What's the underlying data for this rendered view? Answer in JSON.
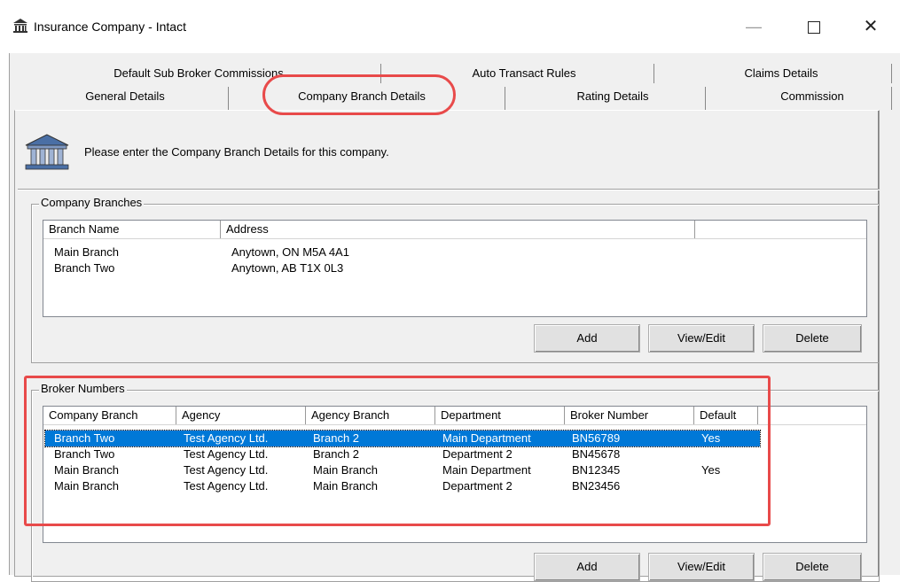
{
  "window": {
    "title": "Insurance Company - Intact",
    "min_glyph": "—",
    "close_glyph": "✕"
  },
  "tabs": {
    "row1": [
      "Default Sub Broker Commissions",
      "Auto Transact Rules",
      "Claims Details"
    ],
    "row2": [
      "General Details",
      "Company Branch Details",
      "Rating Details",
      "Commission"
    ],
    "active": "Company Branch Details"
  },
  "info": {
    "message": "Please enter the Company Branch Details for this company."
  },
  "company_branches": {
    "label": "Company Branches",
    "columns": [
      "Branch Name",
      "Address",
      ""
    ],
    "rows": [
      [
        "Main Branch",
        "Anytown, ON M5A 4A1"
      ],
      [
        "Branch Two",
        "Anytown, AB T1X 0L3"
      ]
    ],
    "buttons": {
      "add": "Add",
      "view_edit": "View/Edit",
      "delete": "Delete"
    }
  },
  "broker_numbers": {
    "label": "Broker Numbers",
    "columns": [
      "Company Branch",
      "Agency",
      "Agency Branch",
      "Department",
      "Broker Number",
      "Default",
      ""
    ],
    "rows": [
      [
        "Branch Two",
        "Test Agency Ltd.",
        "Branch 2",
        "Main Department",
        "BN56789",
        "Yes"
      ],
      [
        "Branch Two",
        "Test Agency Ltd.",
        "Branch 2",
        "Department 2",
        "BN45678",
        ""
      ],
      [
        "Main Branch",
        "Test Agency Ltd.",
        "Main Branch",
        "Main Department",
        "BN12345",
        "Yes"
      ],
      [
        "Main Branch",
        "Test Agency Ltd.",
        "Main Branch",
        "Department 2",
        "BN23456",
        ""
      ]
    ],
    "selected_row": 0,
    "buttons": {
      "add": "Add",
      "view_edit": "View/Edit",
      "delete": "Delete"
    }
  },
  "colors": {
    "selection": "#0078d7",
    "highlight": "#e84a4a",
    "dialog_bg": "#f0f0f0"
  },
  "icons": {
    "app": "bank-building-icon",
    "info": "bank-building-icon"
  }
}
